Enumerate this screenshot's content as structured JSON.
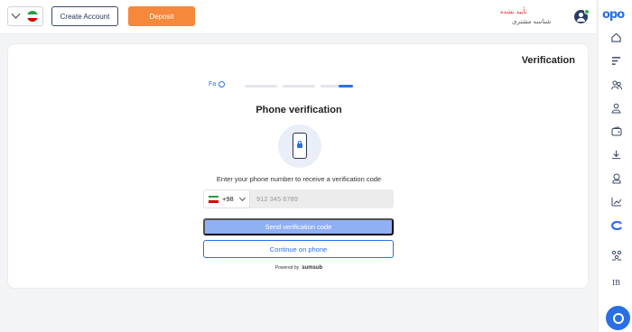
{
  "header": {
    "create_account_label": "Create Account",
    "deposit_label": "Deposit",
    "status_text": "تأیید نشده",
    "username": "شناسه مشتری"
  },
  "sidebar": {
    "logo_text": "opo",
    "items": [
      {
        "icon": "home-icon"
      },
      {
        "icon": "trading-icon"
      },
      {
        "icon": "users-icon"
      },
      {
        "icon": "profile-icon"
      },
      {
        "icon": "wallet-icon"
      },
      {
        "icon": "download-icon"
      },
      {
        "icon": "user-outline-icon"
      },
      {
        "icon": "chart-icon"
      },
      {
        "icon": "copy-trade-icon"
      },
      {
        "icon": "partners-icon"
      },
      {
        "icon": "ib-icon",
        "label": "IB"
      }
    ]
  },
  "verification": {
    "title": "Verification",
    "language": "Fa",
    "progress": [
      1,
      1,
      0.45
    ],
    "heading": "Phone verification",
    "instruction": "Enter your phone number to receive a verification code",
    "country_code": "+98",
    "phone_placeholder": "912 345 6789",
    "send_button": "Send verification code",
    "continue_button": "Continue on phone",
    "powered_by": "Powered by",
    "provider": "sumsub"
  },
  "colors": {
    "accent": "#2b6fe4",
    "deposit": "#f5883a",
    "alert": "#e0343a"
  }
}
